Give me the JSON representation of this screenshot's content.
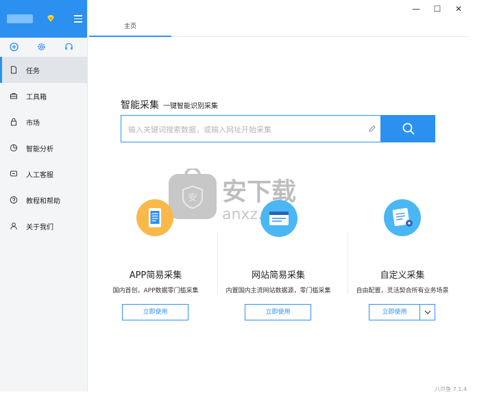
{
  "window": {
    "minimize": "—",
    "maximize": "☐",
    "close": "✕"
  },
  "sidebar": {
    "tools": [
      "add-icon",
      "gear-icon",
      "headset-icon"
    ],
    "items": [
      {
        "label": "任务",
        "icon": "document-icon"
      },
      {
        "label": "工具箱",
        "icon": "toolbox-icon"
      },
      {
        "label": "市场",
        "icon": "bag-icon"
      },
      {
        "label": "智能分析",
        "icon": "chart-icon"
      },
      {
        "label": "人工客服",
        "icon": "chat-icon"
      },
      {
        "label": "教程和帮助",
        "icon": "help-icon"
      },
      {
        "label": "关于我们",
        "icon": "person-icon"
      }
    ]
  },
  "tabs": [
    {
      "label": "主页"
    }
  ],
  "smart": {
    "title": "智能采集",
    "subtitle": "一键智能识别采集",
    "placeholder": "输入关键词搜索数据，或输入网址开始采集"
  },
  "cards": [
    {
      "title": "APP简易采集",
      "desc": "国内首创，APP数据零门槛采集",
      "button": "立即使用",
      "icon": "phone-icon",
      "color": "#f9b94a"
    },
    {
      "title": "网站简易采集",
      "desc": "内置国内主流网站数据源，零门槛采集",
      "button": "立即使用",
      "icon": "browser-icon",
      "color": "#4ab7f4"
    },
    {
      "title": "自定义采集",
      "desc": "自由配置，灵活契合所有业务场景",
      "button": "立即使用",
      "icon": "doc-gear-icon",
      "color": "#4ab7f4"
    }
  ],
  "watermark": {
    "cn": "安下载",
    "en": "anxz.com"
  },
  "version": "八爪鱼 7.1.4",
  "colors": {
    "accent": "#2b90f0",
    "sidebar_bg": "#f4f5f7"
  }
}
